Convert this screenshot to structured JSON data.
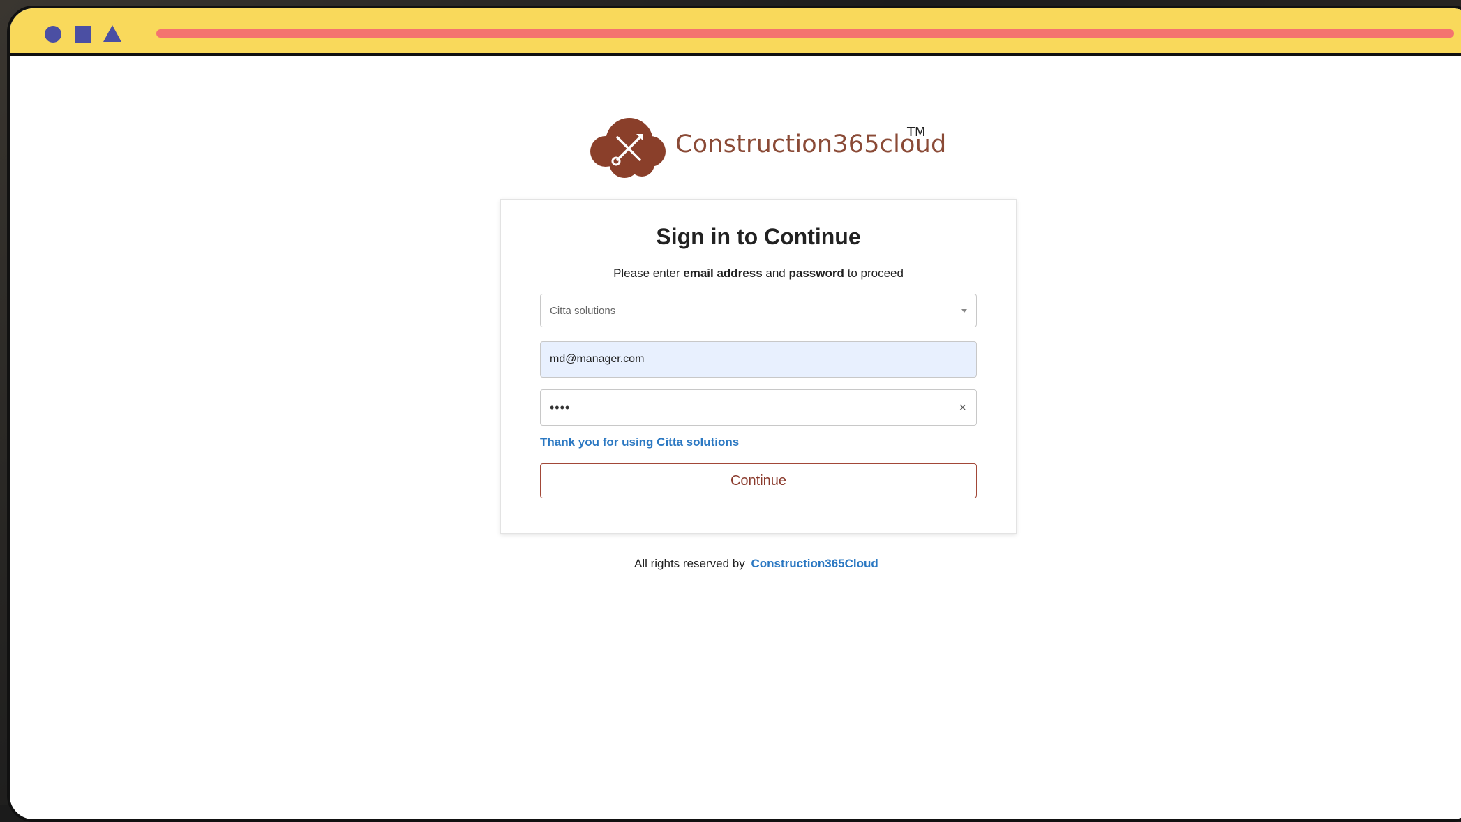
{
  "window": {
    "controls": [
      "circle-control",
      "square-control",
      "triangle-control"
    ]
  },
  "colors": {
    "titlebar": "#f9d95b",
    "address_bar": "#f4736f",
    "window_controls": "#4b4fa3",
    "brand": "#8a4a36",
    "link": "#2b78c2",
    "email_field_bg": "#e8f0fe",
    "continue_border": "#a24838"
  },
  "logo": {
    "icon": "tools-cloud-icon",
    "text": "Construction365cloud",
    "trademark": "TM"
  },
  "signin": {
    "title": "Sign in to Continue",
    "subtitle_prefix": "Please enter",
    "subtitle_bold1": "email address",
    "subtitle_mid": "and",
    "subtitle_bold2": "password",
    "subtitle_suffix": "to proceed",
    "company_select": {
      "value": "Citta solutions",
      "icon": "caret-down-icon"
    },
    "email": {
      "value": "md@manager.com"
    },
    "password": {
      "masked_value": "••••",
      "clear_label": "×"
    },
    "thanks_link": "Thank you for using Citta solutions",
    "continue_label": "Continue"
  },
  "footer": {
    "prefix": "All rights reserved by",
    "link": "Construction365Cloud"
  }
}
